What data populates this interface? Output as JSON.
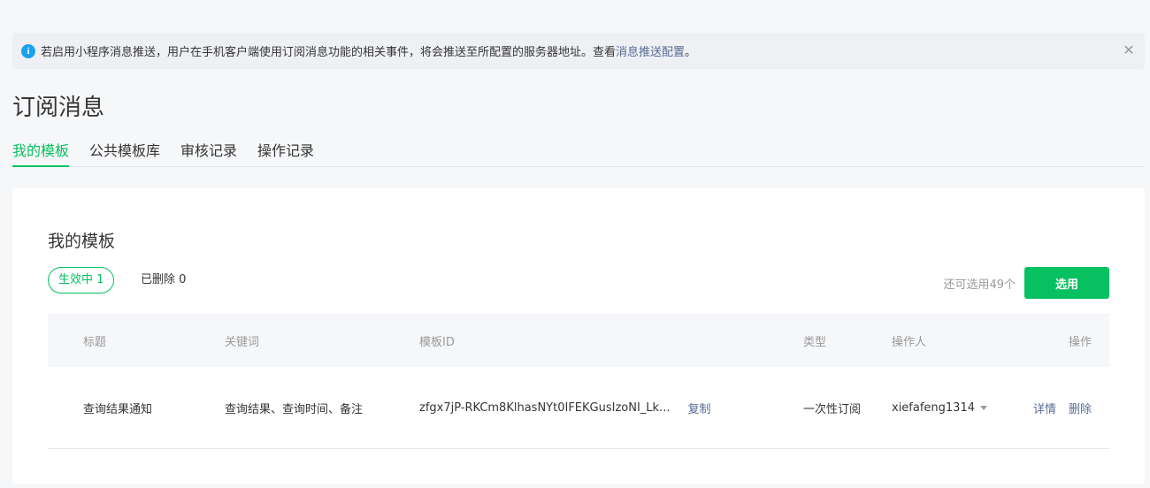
{
  "notice": {
    "text": "若启用小程序消息推送，用户在手机客户端使用订阅消息功能的相关事件，将会推送至所配置的服务器地址。查看 ",
    "link": "消息推送配置",
    "suffix": "。"
  },
  "page_title": "订阅消息",
  "tabs": [
    {
      "label": "我的模板",
      "active": true
    },
    {
      "label": "公共模板库",
      "active": false
    },
    {
      "label": "审核记录",
      "active": false
    },
    {
      "label": "操作记录",
      "active": false
    }
  ],
  "card": {
    "title": "我的模板",
    "filter_active": "生效中  1",
    "filter_deleted": "已删除  0",
    "remain": "还可选用49个",
    "select_button": "选用"
  },
  "table": {
    "headers": {
      "title": "标题",
      "keywords": "关键词",
      "template_id": "模板ID",
      "type": "类型",
      "operator": "操作人",
      "actions": "操作"
    },
    "rows": [
      {
        "title": "查询结果通知",
        "keywords": "查询结果、查询时间、备注",
        "template_id": "zfgx7jP-RKCm8KlhasNYt0IFEKGusIzoNI_Lk...",
        "copy": "复制",
        "type": "一次性订阅",
        "operator": "xiefafeng1314",
        "detail": "详情",
        "delete": "删除"
      }
    ]
  },
  "colors": {
    "accent": "#07c160",
    "link": "#576b95",
    "info": "#1aa1f0"
  }
}
